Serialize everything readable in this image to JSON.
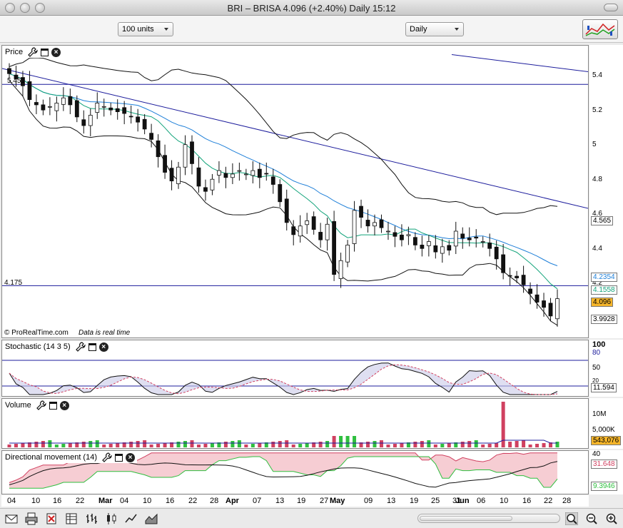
{
  "window": {
    "title": "BRI – BRISA     4.096  (+2.40%)    Daily   15:12"
  },
  "toolbar": {
    "units_select": "100 units",
    "period_select": "Daily"
  },
  "price_panel": {
    "label": "Price",
    "watermark": "© ProRealTime.com",
    "realtime_note": "Data is real time",
    "level_high": "5.451",
    "level_low": "4.175",
    "ticks": [
      "5.4",
      "5.2",
      "5",
      "4.8",
      "4.6",
      "4.4",
      "4.2"
    ],
    "tags": {
      "bb_upper": "4.565",
      "ma_slow": "4.2354",
      "ma_fast": "4.1558",
      "last": "4.096",
      "bb_lower": "3.9928"
    },
    "colors": {
      "last_tag": "#f5b52a",
      "ma_slow": "#1e7fd8",
      "ma_fast": "#12a37a",
      "trend": "#1c1c9c"
    }
  },
  "stochastic_panel": {
    "label": "Stochastic (14 3 5)",
    "ticks": [
      "100",
      "80",
      "50",
      "20"
    ],
    "value_tag": "11.594"
  },
  "volume_panel": {
    "label": "Volume",
    "ticks": [
      "10M",
      "5,000K"
    ],
    "value_tag": "543,076",
    "colors": {
      "up": "#2fbf3f",
      "down": "#d04060",
      "value_tag": "#f5b52a"
    }
  },
  "dm_panel": {
    "label": "Directional movement (14)",
    "ticks": [
      "40"
    ],
    "tags": {
      "di_minus": "31.648",
      "di_plus": "9.3946"
    },
    "colors": {
      "di_minus": "#d04060",
      "di_plus": "#2fbf3f"
    }
  },
  "date_axis": [
    {
      "t": "04",
      "b": false
    },
    {
      "t": "10",
      "b": false
    },
    {
      "t": "16",
      "b": false
    },
    {
      "t": "22",
      "b": false
    },
    {
      "t": "Mar",
      "b": true
    },
    {
      "t": "04",
      "b": false
    },
    {
      "t": "10",
      "b": false
    },
    {
      "t": "16",
      "b": false
    },
    {
      "t": "22",
      "b": false
    },
    {
      "t": "28",
      "b": false
    },
    {
      "t": "Apr",
      "b": true
    },
    {
      "t": "07",
      "b": false
    },
    {
      "t": "13",
      "b": false
    },
    {
      "t": "19",
      "b": false
    },
    {
      "t": "27",
      "b": false
    },
    {
      "t": "May",
      "b": true
    },
    {
      "t": "09",
      "b": false
    },
    {
      "t": "13",
      "b": false
    },
    {
      "t": "19",
      "b": false
    },
    {
      "t": "25",
      "b": false
    },
    {
      "t": "31",
      "b": false
    },
    {
      "t": "Jun",
      "b": true
    },
    {
      "t": "06",
      "b": false
    },
    {
      "t": "10",
      "b": false
    },
    {
      "t": "16",
      "b": false
    },
    {
      "t": "22",
      "b": false
    },
    {
      "t": "28",
      "b": false
    }
  ],
  "bottom_toolbar": {
    "icons": [
      "mail-icon",
      "print-icon",
      "delete-icon",
      "spreadsheet-icon",
      "bar-chart-icon",
      "candlestick-icon",
      "line-chart-icon",
      "mountain-chart-icon",
      "zoom-fit-icon",
      "zoom-out-icon",
      "zoom-in-icon"
    ]
  },
  "chart_data": {
    "type": "candlestick",
    "instrument": "BRI – BRISA",
    "period": "Daily",
    "close": [
      5.4,
      5.37,
      5.33,
      5.25,
      5.22,
      5.19,
      5.21,
      5.23,
      5.26,
      5.22,
      5.15,
      5.1,
      5.16,
      5.23,
      5.21,
      5.19,
      5.18,
      5.17,
      5.15,
      5.12,
      5.08,
      5.02,
      4.92,
      4.83,
      4.78,
      4.86,
      4.99,
      4.88,
      4.75,
      4.72,
      4.79,
      4.84,
      4.8,
      4.82,
      4.84,
      4.82,
      4.84,
      4.8,
      4.82,
      4.76,
      4.66,
      4.54,
      4.47,
      4.52,
      4.55,
      4.5,
      4.44,
      4.53,
      4.24,
      4.32,
      4.41,
      4.61,
      4.57,
      4.52,
      4.54,
      4.51,
      4.49,
      4.46,
      4.44,
      4.47,
      4.41,
      4.39,
      4.43,
      4.37,
      4.4,
      4.38,
      4.49,
      4.45,
      4.44,
      4.45,
      4.43,
      4.39,
      4.33,
      4.25,
      4.23,
      4.22,
      4.18,
      4.13,
      4.08,
      4.05,
      4.0,
      4.1
    ],
    "bb_upper": "≈5.45 → 4.565",
    "bb_lower": "≈5.20 → 3.9928",
    "last": 4.096,
    "change_pct": 2.4,
    "ylim": [
      3.95,
      5.5
    ]
  }
}
